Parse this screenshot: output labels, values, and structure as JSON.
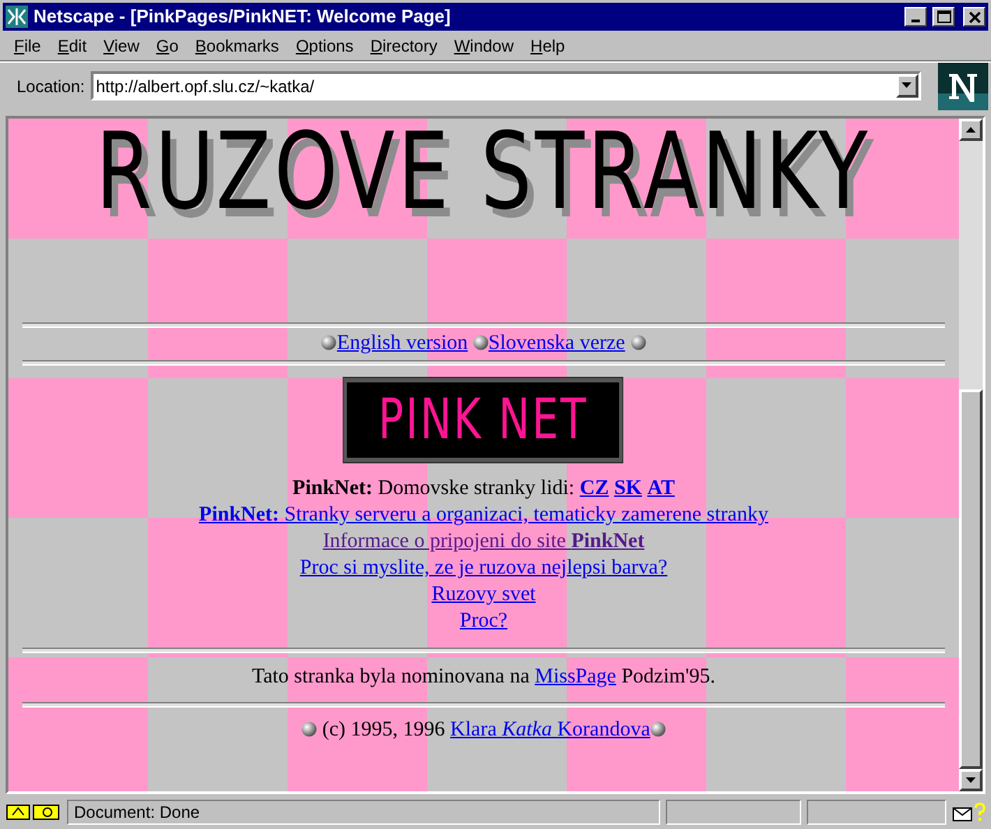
{
  "window": {
    "title": "Netscape - [PinkPages/PinkNET: Welcome Page]"
  },
  "menu": [
    "File",
    "Edit",
    "View",
    "Go",
    "Bookmarks",
    "Options",
    "Directory",
    "Window",
    "Help"
  ],
  "location": {
    "label": "Location:",
    "value": "http://albert.opf.slu.cz/~katka/"
  },
  "banner": {
    "text": "RUZOVE STRANKY"
  },
  "language_links": [
    "English version",
    "Slovenska verze"
  ],
  "logo": {
    "text": "PINK NET"
  },
  "lines": [
    {
      "kind": "mixed",
      "label": "PinkNet:",
      "text": "Domovske stranky lidi:",
      "links": [
        "CZ",
        "SK",
        "AT"
      ]
    },
    {
      "kind": "link",
      "text": "**PinkNet:** Stranky serveru a organizaci, tematicky zamerene stranky",
      "visited": false
    },
    {
      "kind": "link",
      "text": "Informace o pripojeni do site **PinkNet**",
      "visited": true
    },
    {
      "kind": "link",
      "text": "Proc si myslite, ze je ruzova nejlepsi barva?",
      "visited": false
    },
    {
      "kind": "link",
      "text": "Ruzovy svet",
      "visited": false
    },
    {
      "kind": "link",
      "text": "Proc?",
      "visited": false
    }
  ],
  "nomination": {
    "before": "Tato stranka byla nominovana na",
    "link": "MissPage",
    "after": "Podzim'95."
  },
  "copyright": {
    "text": "(c) 1995, 1996",
    "link": "Klara *Katka* Korandova"
  },
  "status_bar": {
    "text": "Document: Done"
  }
}
